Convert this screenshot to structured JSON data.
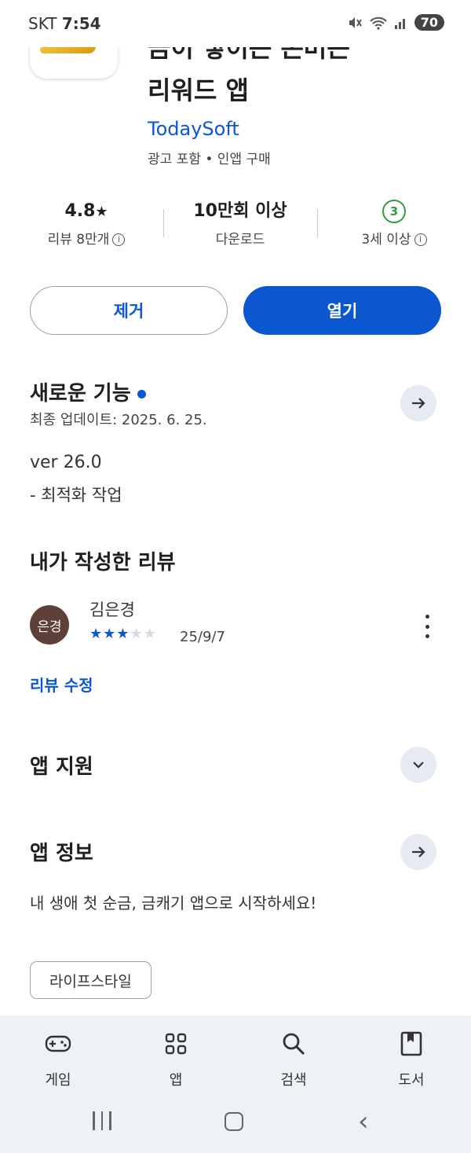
{
  "status_bar": {
    "carrier": "SKT",
    "time": "7:54",
    "battery": "70"
  },
  "app": {
    "title_line1": "금이 쌓이는 돈버는",
    "title_line2": "리워드 앱",
    "developer": "TodaySoft",
    "meta": "광고 포함 • 인앱 구매"
  },
  "stats": {
    "rating": "4.8",
    "reviews": "리뷰 8만개",
    "downloads": "10만회 이상",
    "downloads_label": "다운로드",
    "age_badge": "3",
    "age_label": "3세 이상"
  },
  "buttons": {
    "remove": "제거",
    "open": "열기"
  },
  "whats_new": {
    "title": "새로운 기능",
    "updated": "최종 업데이트: 2025. 6. 25.",
    "version": "ver 26.0",
    "note": "- 최적화 작업"
  },
  "my_review": {
    "title": "내가 작성한 리뷰",
    "avatar_text": "은경",
    "author": "김은경",
    "stars": 3,
    "stars_max": 5,
    "date": "25/9/7",
    "edit": "리뷰 수정"
  },
  "app_support": {
    "title": "앱 지원"
  },
  "app_info": {
    "title": "앱 정보",
    "description": "내 생애 첫 순금, 금캐기 앱으로 시작하세요!",
    "category": "라이프스타일"
  },
  "bottom_nav": {
    "items": [
      {
        "label": "게임",
        "icon": "gamepad-icon"
      },
      {
        "label": "앱",
        "icon": "apps-grid-icon"
      },
      {
        "label": "검색",
        "icon": "search-icon"
      },
      {
        "label": "도서",
        "icon": "book-icon"
      }
    ]
  },
  "colors": {
    "accent": "#0b57d0",
    "age_badge": "#2e9e3e",
    "avatar": "#5d4037"
  }
}
